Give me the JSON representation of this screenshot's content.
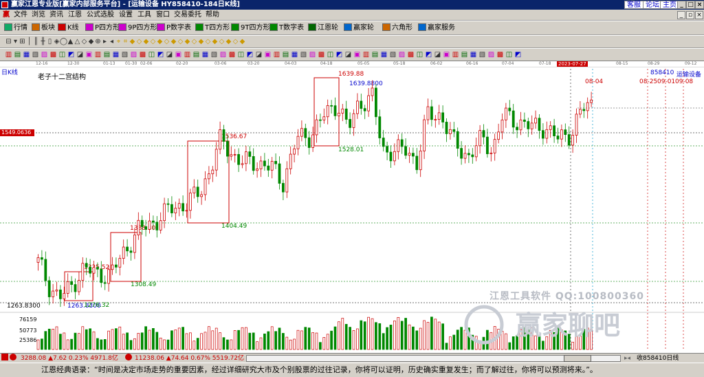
{
  "titlebar": {
    "title": "赢家江恩专业版[赢家内部服务平台] - [运输设备  HY858410-184日K线]",
    "link_support": "客服",
    "link_forum": "论坛",
    "link_home": "主页"
  },
  "menu": {
    "items": [
      "文件",
      "浏览",
      "资讯",
      "江恩",
      "公式选股",
      "设置",
      "工具",
      "窗口",
      "交易委托",
      "帮助"
    ]
  },
  "toolbar1": {
    "items": [
      {
        "label": "行情",
        "icon": "grid-icon",
        "color": "#1a6"
      },
      {
        "label": "板块",
        "icon": "block-icon",
        "color": "#c60"
      },
      {
        "label": "K线",
        "icon": "kline-icon",
        "color": "#c00"
      },
      {
        "label": "P四方形",
        "icon": "p-square-icon",
        "color": "#c0c"
      },
      {
        "label": "9P四方形",
        "icon": "9p-square-icon",
        "color": "#c0c"
      },
      {
        "label": "P数字表",
        "icon": "p-table-icon",
        "color": "#c0c"
      },
      {
        "label": "T四方形",
        "icon": "t-square-icon",
        "color": "#080"
      },
      {
        "label": "9T四方形",
        "icon": "9t-square-icon",
        "color": "#080"
      },
      {
        "label": "T数字表",
        "icon": "t-table-icon",
        "color": "#080"
      },
      {
        "label": "江恩轮",
        "icon": "wheel-icon",
        "color": "#060"
      },
      {
        "label": "赢家轮",
        "icon": "winner-wheel-icon",
        "color": "#06c"
      },
      {
        "label": "六角形",
        "icon": "hexagon-icon",
        "color": "#c60"
      },
      {
        "label": "赢家服务",
        "icon": "service-icon",
        "color": "#06c"
      }
    ]
  },
  "datebar": {
    "dates": [
      "12-16",
      "12-30",
      "01-13",
      "01-30",
      "02-06",
      "02-20",
      "03-06",
      "03-20",
      "04-03",
      "04-18",
      "05-05",
      "05-18",
      "06-02",
      "06-16",
      "07-04",
      "07-18",
      "2023-07-27",
      "08-15",
      "08-29",
      "09-12"
    ],
    "highlight": "2023-07-27"
  },
  "chart": {
    "period_label": "日K线",
    "structure_title": "老子十二宫结构",
    "code": "858410",
    "name": "运输设备",
    "current_price_tag": "1549.0636",
    "low_tag": "1263.8300",
    "future_dates": [
      "08-04",
      "08-25",
      "09-01",
      "09-08"
    ],
    "box_labels": [
      {
        "text": "1639.88",
        "color": "#c00"
      },
      {
        "text": "1639.8800",
        "color": "#00c"
      },
      {
        "text": "1528.01",
        "color": "#080"
      },
      {
        "text": "1536.67",
        "color": "#c00"
      },
      {
        "text": "1404.49",
        "color": "#080"
      },
      {
        "text": "1388.30",
        "color": "#c00"
      },
      {
        "text": "1308.49",
        "color": "#080"
      },
      {
        "text": "1325.52",
        "color": "#c00"
      },
      {
        "text": "1263.8300",
        "color": "#00c"
      },
      {
        "text": "1276.32",
        "color": "#080"
      }
    ]
  },
  "volume": {
    "labels": [
      "76159",
      "50773",
      "25386"
    ]
  },
  "watermark": {
    "text1": "江恩工具软件  QQ:100800360",
    "text2": "赢家聊吧"
  },
  "statusbar": {
    "index1": "3288.08 ▲7.62 0.23% 4971.8亿",
    "index2": "11238.06 ▲74.64 0.67% 5519.72亿",
    "right_label": "收858410日线"
  },
  "quote": "江恩经典语录：“时间是决定市场走势的重要因素，经过详细研究大市及个别股票的过往记录，你将可以证明，历史确实重复发生；而了解过往，你将可以预测将来。”。",
  "chart_data": {
    "type": "candlestick",
    "title": "老子十二宫结构",
    "period": "日K线",
    "x": [
      "12-16",
      "12-30",
      "01-13",
      "01-30",
      "02-06",
      "02-20",
      "03-06",
      "03-20",
      "04-03",
      "04-18",
      "05-05",
      "05-18",
      "06-02",
      "06-16",
      "07-04",
      "07-18",
      "2023-07-27"
    ],
    "close_approx": [
      1300,
      1270,
      1310,
      1330,
      1380,
      1410,
      1520,
      1500,
      1480,
      1560,
      1600,
      1540,
      1560,
      1520,
      1570,
      1560,
      1580
    ],
    "current": 1549.0636,
    "levels": [
      1263.83,
      1276.32,
      1308.49,
      1325.52,
      1388.3,
      1404.49,
      1528.01,
      1536.67,
      1639.88
    ],
    "volume_ticks": [
      25386,
      50773,
      76159
    ]
  }
}
